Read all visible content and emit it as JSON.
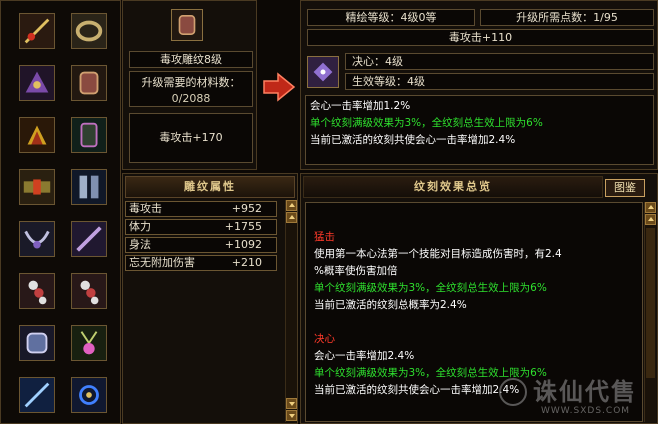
{
  "selected": {
    "name": "毒攻雕纹8级",
    "materials_label": "升级需要的材料数：",
    "materials_value": "0/2088",
    "bonus": "毒攻击+170"
  },
  "upgrade": {
    "level_label": "精绘等级：4级0等",
    "points_label": "升级所需点数：1/95",
    "bonus": "毒攻击+110",
    "skill": "决心：4级",
    "effect_level": "生效等级：4级",
    "desc": [
      {
        "text": "会心一击率增加1.2%",
        "color": "white"
      },
      {
        "text": "单个纹刻满级效果为3%，全纹刻总生效上限为6%",
        "color": "green"
      },
      {
        "text": "当前已激活的纹刻共使会心一击率增加2.4%",
        "color": "white"
      }
    ]
  },
  "attributes": {
    "title": "雕纹属性",
    "rows": [
      {
        "name": "毒攻击",
        "value": "+952"
      },
      {
        "name": "体力",
        "value": "+1755"
      },
      {
        "name": "身法",
        "value": "+1092"
      },
      {
        "name": "忘无附加伤害",
        "value": "+210"
      }
    ]
  },
  "overview": {
    "title": "纹刻效果总览",
    "button": "图鉴",
    "sections": [
      {
        "name": "猛击",
        "lines": [
          {
            "text": "使用第一本心法第一个技能对目标造成伤害时，有2.4",
            "color": "white"
          },
          {
            "text": "%概率使伤害加倍",
            "color": "white"
          },
          {
            "text": "单个纹刻满级效果为3%，全纹刻总生效上限为6%",
            "color": "green"
          },
          {
            "text": "当前已激活的纹刻总概率为2.4%",
            "color": "white"
          }
        ]
      },
      {
        "name": "决心",
        "lines": [
          {
            "text": "会心一击率增加2.4%",
            "color": "white"
          },
          {
            "text": "单个纹刻满级效果为3%，全纹刻总生效上限为6%",
            "color": "green"
          },
          {
            "text": "当前已激活的纹刻共使会心一击率增加2.4%",
            "color": "white"
          }
        ]
      }
    ]
  },
  "watermark": {
    "brand": "诛仙代售",
    "url": "WWW.SXDS.COM"
  },
  "colors": {
    "accent_gold": "#e0c88c",
    "green_text": "#2ee02e",
    "red_text": "#ff3a2a",
    "border": "#6b5632"
  },
  "icons": {
    "equipment": [
      "sword-icon",
      "ring-icon",
      "helmet-icon",
      "bracelet-icon",
      "shoulder-icon",
      "glove-icon",
      "belt-icon",
      "boots-icon",
      "necklace-icon",
      "charm-icon",
      "pendant-icon",
      "talisman-icon",
      "bracer-icon",
      "amulet-icon",
      "spear-icon",
      "accessory-icon"
    ],
    "selected_item": "bracelet-icon",
    "skill": "rune-icon",
    "arrow": "arrow-right-icon"
  }
}
